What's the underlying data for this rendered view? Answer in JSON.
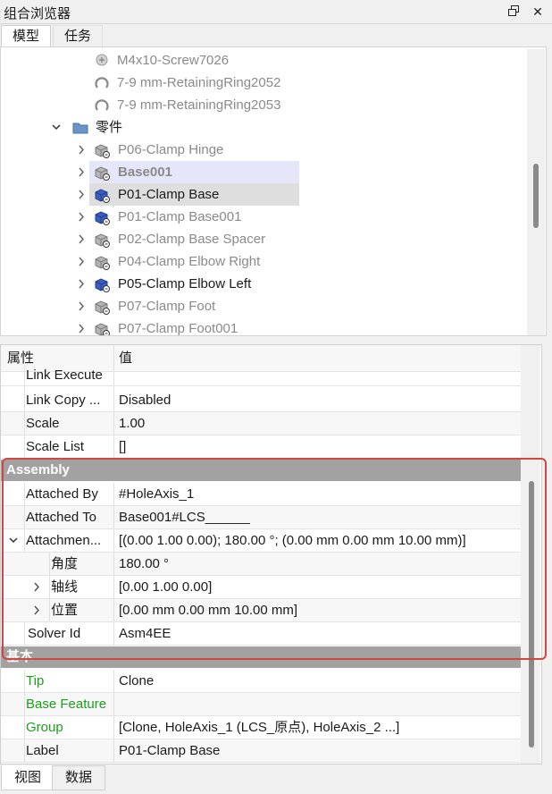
{
  "window": {
    "title": "组合浏览器"
  },
  "top_tabs": [
    {
      "label": "模型"
    },
    {
      "label": "任务"
    }
  ],
  "tree": {
    "items": [
      {
        "label": "M4x10-Screw7026",
        "icon": "screw-icon"
      },
      {
        "label": "7-9 mm-RetainingRing2052",
        "icon": "retaining-ring-icon"
      },
      {
        "label": "7-9 mm-RetainingRing2053",
        "icon": "retaining-ring-icon"
      },
      {
        "label": "零件",
        "icon": "folder-icon"
      },
      {
        "label": "P06-Clamp Hinge",
        "icon": "link-part-icon"
      },
      {
        "label": "Base001",
        "icon": "link-part-icon"
      },
      {
        "label": "P01-Clamp Base",
        "icon": "link-part-icon"
      },
      {
        "label": "P01-Clamp Base001",
        "icon": "link-part-icon"
      },
      {
        "label": "P02-Clamp Base Spacer",
        "icon": "link-part-icon"
      },
      {
        "label": "P04-Clamp Elbow Right",
        "icon": "link-part-icon"
      },
      {
        "label": "P05-Clamp Elbow Left",
        "icon": "link-part-icon"
      },
      {
        "label": "P07-Clamp Foot",
        "icon": "link-part-icon"
      },
      {
        "label": "P07-Clamp Foot001",
        "icon": "link-part-icon"
      }
    ]
  },
  "properties": {
    "header": {
      "key": "属性",
      "value": "值"
    },
    "rows": [
      {
        "key": "Link Execute",
        "value": ""
      },
      {
        "key": "Link Copy ...",
        "value": "Disabled"
      },
      {
        "key": "Scale",
        "value": "1.00"
      },
      {
        "key": "Scale List",
        "value": "[]"
      }
    ],
    "assembly_group": "Assembly",
    "assembly_rows": [
      {
        "key": "Attached By",
        "value": "#HoleAxis_1"
      },
      {
        "key": "Attached To",
        "value": "Base001#LCS______"
      },
      {
        "key": "Attachmen...",
        "value": "[(0.00 1.00 0.00); 180.00 °; (0.00 mm  0.00 mm  10.00 mm)]"
      },
      {
        "key": "角度",
        "value": "180.00 °"
      },
      {
        "key": "轴线",
        "value": "[0.00 1.00 0.00]"
      },
      {
        "key": "位置",
        "value": "[0.00 mm  0.00 mm  10.00 mm]"
      },
      {
        "key": "Solver Id",
        "value": "Asm4EE"
      }
    ],
    "base_group": "基本",
    "base_rows": [
      {
        "key": "Tip",
        "value": "Clone"
      },
      {
        "key": "Base Feature",
        "value": ""
      },
      {
        "key": "Group",
        "value": "[Clone, HoleAxis_1 (LCS_原点), HoleAxis_2 ...]"
      },
      {
        "key": "Label",
        "value": "P01-Clamp Base"
      }
    ]
  },
  "bottom_tabs": [
    {
      "label": "视图"
    },
    {
      "label": "数据"
    }
  ],
  "colors": {
    "highlight": "#d24646",
    "group_header": "#a2a2a2",
    "green_label": "#1e9e1e",
    "selection": "#e6e6fa"
  }
}
